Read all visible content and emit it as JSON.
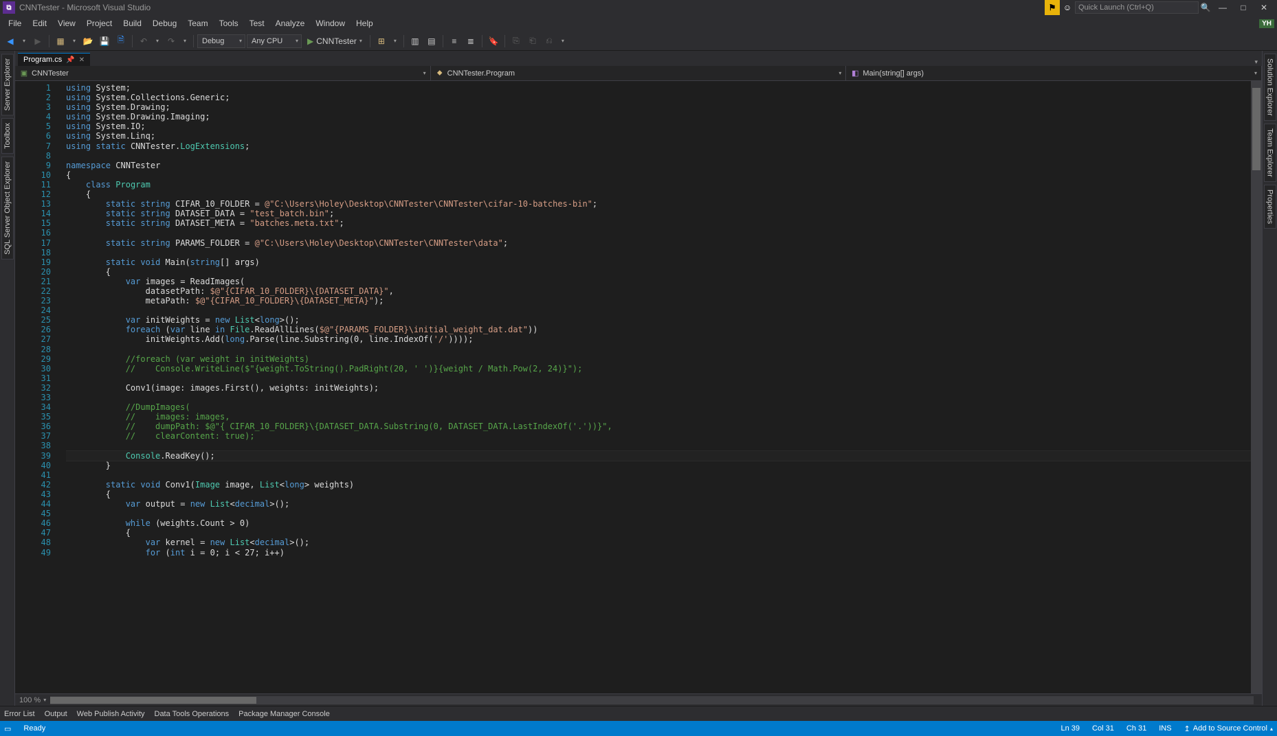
{
  "window": {
    "title": "CNNTester - Microsoft Visual Studio",
    "quick_launch_placeholder": "Quick Launch (Ctrl+Q)",
    "user_badge": "YH"
  },
  "menu": [
    "File",
    "Edit",
    "View",
    "Project",
    "Build",
    "Debug",
    "Team",
    "Tools",
    "Test",
    "Analyze",
    "Window",
    "Help"
  ],
  "toolbar": {
    "config": "Debug",
    "platform": "Any CPU",
    "start_label": "CNNTester"
  },
  "side_left": [
    "Server Explorer",
    "Toolbox",
    "SQL Server Object Explorer"
  ],
  "side_right": [
    "Solution Explorer",
    "Team Explorer",
    "Properties"
  ],
  "tab": {
    "name": "Program.cs"
  },
  "nav": {
    "project": "CNNTester",
    "class": "CNNTester.Program",
    "member": "Main(string[] args)"
  },
  "zoom": "100 %",
  "bottom_tabs": [
    "Error List",
    "Output",
    "Web Publish Activity",
    "Data Tools Operations",
    "Package Manager Console"
  ],
  "status": {
    "ready": "Ready",
    "ln": "Ln 39",
    "col": "Col 31",
    "ch": "Ch 31",
    "ins": "INS",
    "src": "Add to Source Control"
  },
  "code_lines": [
    {
      "n": 1,
      "html": "<span class='k'>using</span> <span class='n'>System</span><span class='p'>;</span>"
    },
    {
      "n": 2,
      "html": "<span class='k'>using</span> <span class='n'>System.Collections.Generic</span><span class='p'>;</span>"
    },
    {
      "n": 3,
      "html": "<span class='k'>using</span> <span class='n'>System.Drawing</span><span class='p'>;</span>"
    },
    {
      "n": 4,
      "html": "<span class='k'>using</span> <span class='n'>System.Drawing.Imaging</span><span class='p'>;</span>"
    },
    {
      "n": 5,
      "html": "<span class='k'>using</span> <span class='n'>System.IO</span><span class='p'>;</span>"
    },
    {
      "n": 6,
      "html": "<span class='k'>using</span> <span class='n'>System.Linq</span><span class='p'>;</span>"
    },
    {
      "n": 7,
      "html": "<span class='k'>using</span> <span class='k'>static</span> <span class='n'>CNNTester</span><span class='p'>.</span><span class='t'>LogExtensions</span><span class='p'>;</span>"
    },
    {
      "n": 8,
      "html": ""
    },
    {
      "n": 9,
      "html": "<span class='k'>namespace</span> <span class='n'>CNNTester</span>"
    },
    {
      "n": 10,
      "html": "<span class='p'>{</span>"
    },
    {
      "n": 11,
      "html": "    <span class='k'>class</span> <span class='t'>Program</span>"
    },
    {
      "n": 12,
      "html": "    <span class='p'>{</span>"
    },
    {
      "n": 13,
      "html": "        <span class='k'>static</span> <span class='k'>string</span> <span class='n'>CIFAR_10_FOLDER</span> <span class='p'>=</span> <span class='s'>@\"C:\\Users\\Holey\\Desktop\\CNNTester\\CNNTester\\cifar-10-batches-bin\"</span><span class='p'>;</span>"
    },
    {
      "n": 14,
      "html": "        <span class='k'>static</span> <span class='k'>string</span> <span class='n'>DATASET_DATA</span> <span class='p'>=</span> <span class='s'>\"test_batch.bin\"</span><span class='p'>;</span>"
    },
    {
      "n": 15,
      "html": "        <span class='k'>static</span> <span class='k'>string</span> <span class='n'>DATASET_META</span> <span class='p'>=</span> <span class='s'>\"batches.meta.txt\"</span><span class='p'>;</span>"
    },
    {
      "n": 16,
      "html": ""
    },
    {
      "n": 17,
      "html": "        <span class='k'>static</span> <span class='k'>string</span> <span class='n'>PARAMS_FOLDER</span> <span class='p'>=</span> <span class='s'>@\"C:\\Users\\Holey\\Desktop\\CNNTester\\CNNTester\\data\"</span><span class='p'>;</span>"
    },
    {
      "n": 18,
      "html": ""
    },
    {
      "n": 19,
      "html": "        <span class='k'>static</span> <span class='k'>void</span> <span class='n'>Main</span><span class='p'>(</span><span class='k'>string</span><span class='p'>[] args)</span>"
    },
    {
      "n": 20,
      "html": "        <span class='p'>{</span>"
    },
    {
      "n": 21,
      "html": "            <span class='k'>var</span> <span class='n'>images</span> <span class='p'>= ReadImages(</span>"
    },
    {
      "n": 22,
      "html": "                <span class='n'>datasetPath:</span> <span class='s'>$@\"{CIFAR_10_FOLDER}\\{DATASET_DATA}\"</span><span class='p'>,</span>"
    },
    {
      "n": 23,
      "html": "                <span class='n'>metaPath:</span> <span class='s'>$@\"{CIFAR_10_FOLDER}\\{DATASET_META}\"</span><span class='p'>);</span>"
    },
    {
      "n": 24,
      "html": ""
    },
    {
      "n": 25,
      "html": "            <span class='k'>var</span> <span class='n'>initWeights</span> <span class='p'>=</span> <span class='k'>new</span> <span class='t'>List</span><span class='p'>&lt;</span><span class='k'>long</span><span class='p'>&gt;();</span>"
    },
    {
      "n": 26,
      "html": "            <span class='k'>foreach</span> <span class='p'>(</span><span class='k'>var</span> <span class='n'>line</span> <span class='k'>in</span> <span class='t'>File</span><span class='p'>.ReadAllLines(</span><span class='s'>$@\"{PARAMS_FOLDER}\\initial_weight_dat.dat\"</span><span class='p'>))</span>"
    },
    {
      "n": 27,
      "html": "                <span class='n'>initWeights.Add(</span><span class='k'>long</span><span class='p'>.Parse(line.Substring(0, line.IndexOf(</span><span class='s'>'/'</span><span class='p'>))));</span>"
    },
    {
      "n": 28,
      "html": ""
    },
    {
      "n": 29,
      "html": "            <span class='c'>//foreach (var weight in initWeights)</span>"
    },
    {
      "n": 30,
      "html": "            <span class='c'>//    Console.WriteLine($\"{weight.ToString().PadRight(20, ' ')}{weight / Math.Pow(2, 24)}\");</span>"
    },
    {
      "n": 31,
      "html": ""
    },
    {
      "n": 32,
      "html": "            <span class='n'>Conv1(image: images.First(), weights: initWeights);</span>"
    },
    {
      "n": 33,
      "html": ""
    },
    {
      "n": 34,
      "html": "            <span class='c'>//DumpImages(</span>"
    },
    {
      "n": 35,
      "html": "            <span class='c'>//    images: images,</span>"
    },
    {
      "n": 36,
      "html": "            <span class='c'>//    dumpPath: $@\"{ CIFAR_10_FOLDER}\\{DATASET_DATA.Substring(0, DATASET_DATA.LastIndexOf('.'))}\",</span>"
    },
    {
      "n": 37,
      "html": "            <span class='c'>//    clearContent: true);</span>"
    },
    {
      "n": 38,
      "html": ""
    },
    {
      "n": 39,
      "html": "            <span class='t'>Console</span><span class='p'>.ReadKey();</span>",
      "current": true
    },
    {
      "n": 40,
      "html": "        <span class='p'>}</span>"
    },
    {
      "n": 41,
      "html": ""
    },
    {
      "n": 42,
      "html": "        <span class='k'>static</span> <span class='k'>void</span> <span class='n'>Conv1</span><span class='p'>(</span><span class='t'>Image</span> <span class='n'>image</span><span class='p'>,</span> <span class='t'>List</span><span class='p'>&lt;</span><span class='k'>long</span><span class='p'>&gt; weights)</span>"
    },
    {
      "n": 43,
      "html": "        <span class='p'>{</span>"
    },
    {
      "n": 44,
      "html": "            <span class='k'>var</span> <span class='n'>output</span> <span class='p'>=</span> <span class='k'>new</span> <span class='t'>List</span><span class='p'>&lt;</span><span class='k'>decimal</span><span class='p'>&gt;();</span>"
    },
    {
      "n": 45,
      "html": ""
    },
    {
      "n": 46,
      "html": "            <span class='k'>while</span> <span class='p'>(weights.Count &gt; 0)</span>"
    },
    {
      "n": 47,
      "html": "            <span class='p'>{</span>"
    },
    {
      "n": 48,
      "html": "                <span class='k'>var</span> <span class='n'>kernel</span> <span class='p'>=</span> <span class='k'>new</span> <span class='t'>List</span><span class='p'>&lt;</span><span class='k'>decimal</span><span class='p'>&gt;();</span>"
    },
    {
      "n": 49,
      "html": "                <span class='k'>for</span> <span class='p'>(</span><span class='k'>int</span> <span class='n'>i</span> <span class='p'>= 0; i &lt; 27; i++)</span>"
    }
  ]
}
